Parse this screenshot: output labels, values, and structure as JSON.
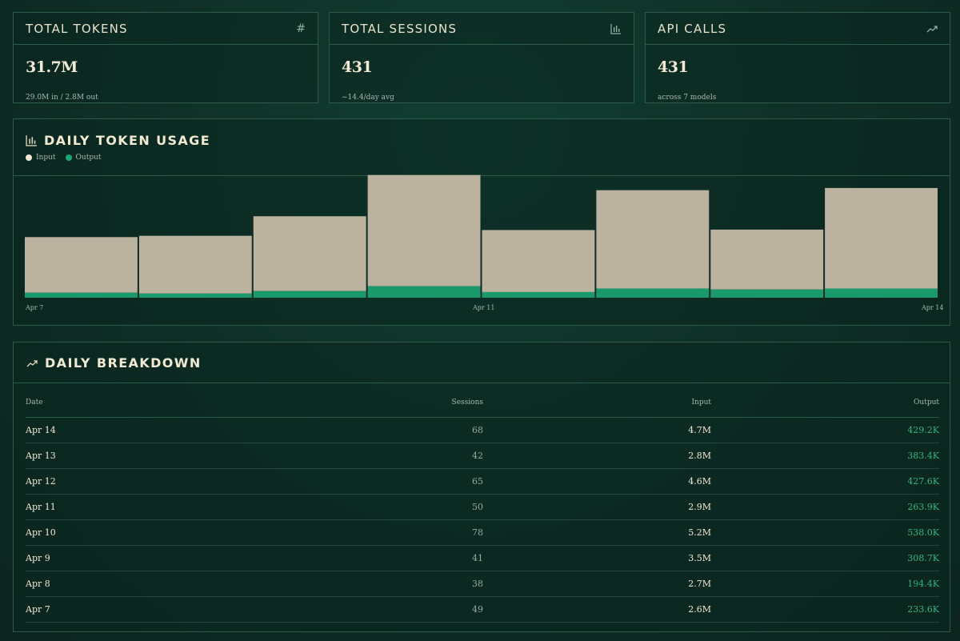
{
  "stats": [
    {
      "title": "TOTAL TOKENS",
      "icon": "hash-icon",
      "icon_glyph": "#",
      "value": "31.7M",
      "sub": "29.0M in / 2.8M out"
    },
    {
      "title": "TOTAL SESSIONS",
      "icon": "bar-chart-icon",
      "icon_glyph": "",
      "value": "431",
      "sub": "~14.4/day avg"
    },
    {
      "title": "API CALLS",
      "icon": "trend-up-icon",
      "icon_glyph": "",
      "value": "431",
      "sub": "across 7 models"
    }
  ],
  "usage": {
    "title": "DAILY TOKEN USAGE",
    "icon": "bar-chart-icon",
    "legend": [
      {
        "label": "Input",
        "color": "#f3ead2"
      },
      {
        "label": "Output",
        "color": "#1ea575"
      }
    ],
    "tick_labels": [
      "Apr 7",
      "Apr 11",
      "Apr 14"
    ]
  },
  "chart_data": {
    "type": "bar",
    "stacked": true,
    "categories": [
      "Apr 7",
      "Apr 8",
      "Apr 9",
      "Apr 10",
      "Apr 11",
      "Apr 12",
      "Apr 13",
      "Apr 14"
    ],
    "series": [
      {
        "name": "Input",
        "color": "#bcb2a0",
        "values": [
          2.6,
          2.7,
          3.5,
          5.2,
          2.9,
          4.6,
          2.8,
          4.7
        ]
      },
      {
        "name": "Output",
        "color": "#1a9a6c",
        "values": [
          0.2336,
          0.1944,
          0.3087,
          0.538,
          0.2639,
          0.4276,
          0.3834,
          0.4292
        ]
      }
    ],
    "unit": "M",
    "xlabel": "",
    "ylabel": "",
    "ylim": [
      0,
      5.8
    ],
    "grid": false,
    "legend": "top-left"
  },
  "breakdown": {
    "title": "DAILY BREAKDOWN",
    "icon": "trend-up-icon",
    "columns": [
      "Date",
      "Sessions",
      "Input",
      "Output"
    ],
    "rows": [
      {
        "date": "Apr 14",
        "sessions": "68",
        "input": "4.7M",
        "output": "429.2K"
      },
      {
        "date": "Apr 13",
        "sessions": "42",
        "input": "2.8M",
        "output": "383.4K"
      },
      {
        "date": "Apr 12",
        "sessions": "65",
        "input": "4.6M",
        "output": "427.6K"
      },
      {
        "date": "Apr 11",
        "sessions": "50",
        "input": "2.9M",
        "output": "263.9K"
      },
      {
        "date": "Apr 10",
        "sessions": "78",
        "input": "5.2M",
        "output": "538.0K"
      },
      {
        "date": "Apr 9",
        "sessions": "41",
        "input": "3.5M",
        "output": "308.7K"
      },
      {
        "date": "Apr 8",
        "sessions": "38",
        "input": "2.7M",
        "output": "194.4K"
      },
      {
        "date": "Apr 7",
        "sessions": "49",
        "input": "2.6M",
        "output": "233.6K"
      }
    ]
  }
}
